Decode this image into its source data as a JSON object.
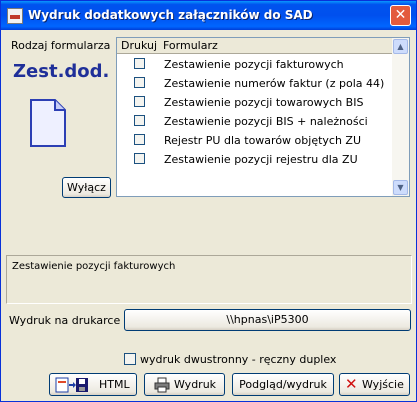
{
  "window": {
    "title": "Wydruk dodatkowych załączników do SAD",
    "close": "✕"
  },
  "form_label": "Rodzaj formularza",
  "brand_text": "Zest.dod.",
  "toggle_button": "Wyłącz",
  "grid": {
    "columns": [
      "Drukuj",
      "Formularz"
    ],
    "rows": [
      {
        "label": "Zestawienie pozycji fakturowych",
        "checked": false
      },
      {
        "label": "Zestawienie numerów faktur (z pola 44)",
        "checked": false
      },
      {
        "label": "Zestawienie pozycji towarowych BIS",
        "checked": false
      },
      {
        "label": "Zestawienie pozycji BIS + należności",
        "checked": false
      },
      {
        "label": "Rejestr PU dla towarów objętych ZU",
        "checked": false
      },
      {
        "label": "Zestawienie pozycji rejestru dla ZU",
        "checked": false
      }
    ]
  },
  "description": "Zestawienie pozycji fakturowych",
  "printer": {
    "label": "Wydruk na drukarce",
    "value": "\\\\hpnas\\iP5300"
  },
  "duplex": {
    "label": "wydruk dwustronny - ręczny duplex",
    "checked": false
  },
  "buttons": {
    "html": "HTML",
    "print": "Wydruk",
    "preview": "Podgląd/wydruk",
    "exit": "Wyjście"
  }
}
